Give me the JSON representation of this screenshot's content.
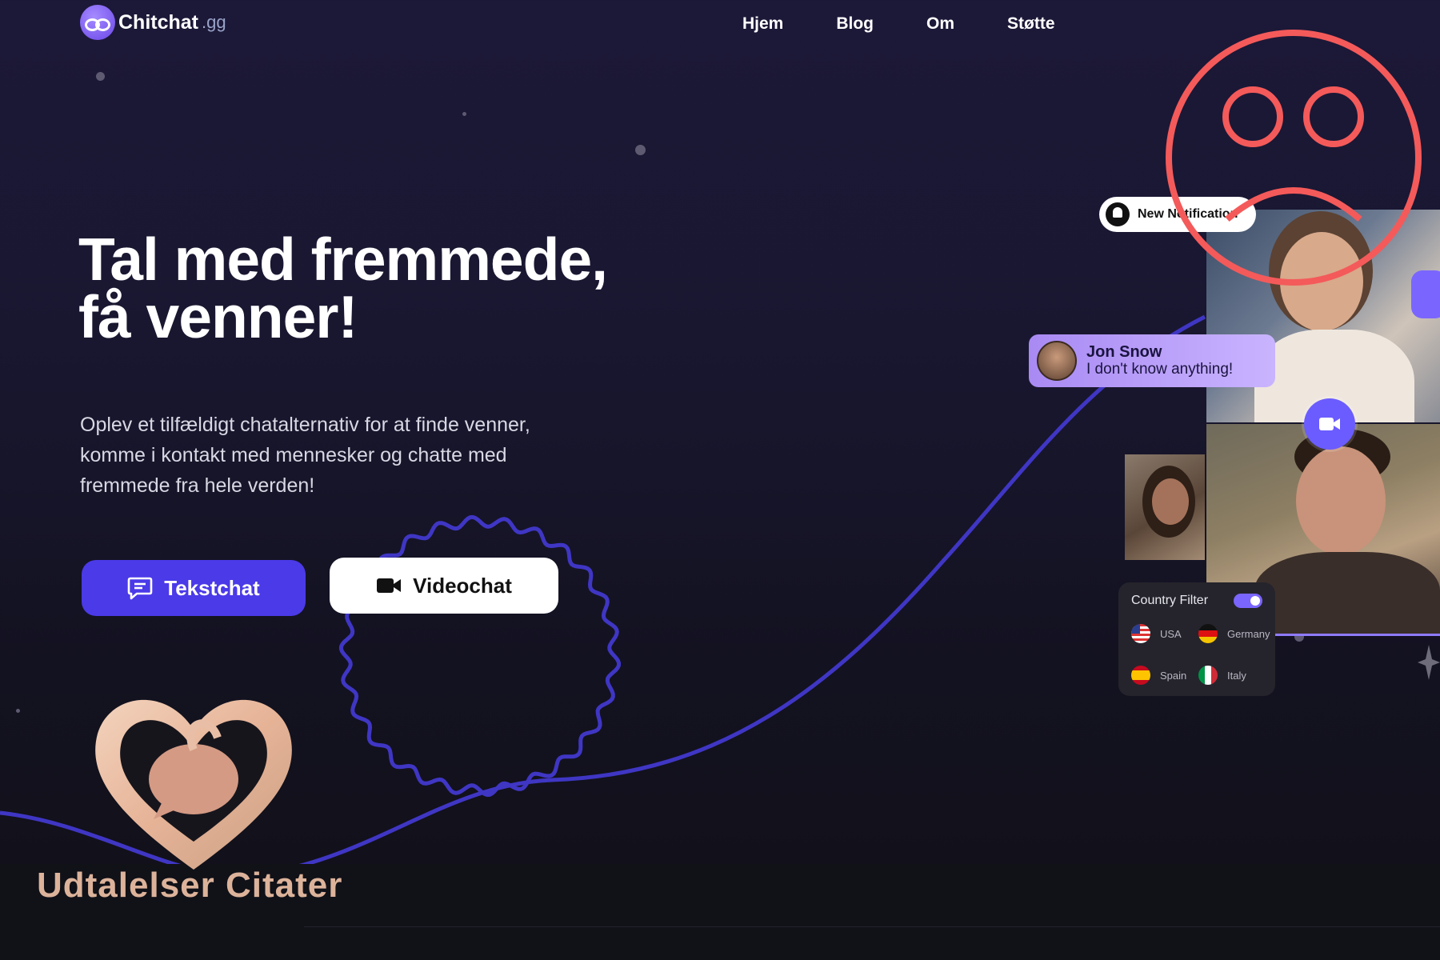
{
  "brand": {
    "name": "Chitchat",
    "tld": ".gg"
  },
  "nav": {
    "items": [
      "Hjem",
      "Blog",
      "Om",
      "Støtte"
    ]
  },
  "hero": {
    "title_line1": "Tal med fremmede,",
    "title_line2": "få venner!",
    "subtitle": "Oplev et tilfældigt chatalternativ for at finde venner, komme i kontakt med mennesker og chatte med fremmede fra hele verden!",
    "text_chat_label": "Tekstchat",
    "video_chat_label": "Videochat"
  },
  "notification": {
    "label": "New Notification"
  },
  "chat_bubble": {
    "name": "Jon Snow",
    "message": "I don't know anything!"
  },
  "country_filter": {
    "title": "Country Filter",
    "enabled": true,
    "countries": [
      "USA",
      "Germany",
      "Spain",
      "Italy"
    ]
  },
  "overlay": {
    "caption": "Udtalelser Citater"
  },
  "icons": [
    "logo-icon",
    "chat-bubble-icon",
    "video-camera-icon",
    "bell-icon",
    "sad-face-icon",
    "heart-chat-icon"
  ],
  "colors": {
    "accent": "#4b3ae8",
    "toggle": "#7a66ff",
    "sad_face": "#f45a5a",
    "caption": "#dcb39a"
  }
}
